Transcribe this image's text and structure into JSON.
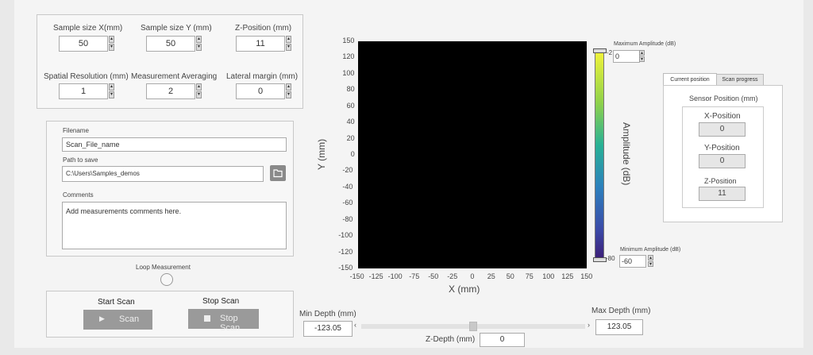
{
  "params": {
    "sample_x_label": "Sample size X(mm)",
    "sample_x_value": "50",
    "sample_y_label": "Sample size Y (mm)",
    "sample_y_value": "50",
    "zpos_label": "Z-Position (mm)",
    "zpos_value": "11",
    "spatial_label": "Spatial Resolution  (mm)",
    "spatial_value": "1",
    "averaging_label": "Measurement Averaging",
    "averaging_value": "2",
    "lateral_label": "Lateral margin  (mm)",
    "lateral_value": "0"
  },
  "file": {
    "filename_label": "Filename",
    "filename_value": "Scan_File_name",
    "path_label": "Path to save",
    "path_value": "C:\\Users\\Samples_demos",
    "comments_label": "Comments",
    "comments_value": "Add measurements comments here."
  },
  "loop": {
    "label": "Loop Measurement"
  },
  "controls": {
    "start_title": "Start Scan",
    "start_label": "Scan",
    "stop_title": "Stop Scan",
    "stop_label": "Stop Scan"
  },
  "plot": {
    "xlabel": "X (mm)",
    "ylabel": "Y (mm)",
    "xticks": [
      "-150",
      "-125",
      "-100",
      "-75",
      "-50",
      "-25",
      "0",
      "25",
      "50",
      "75",
      "100",
      "125",
      "150"
    ],
    "yticks": [
      "150",
      "120",
      "100",
      "80",
      "60",
      "40",
      "20",
      "0",
      "-20",
      "-40",
      "-60",
      "-80",
      "-100",
      "-120",
      "-150"
    ],
    "colorbar_label": "Amplitude (dB)",
    "cb_max_tick": "-2",
    "cb_min_tick": "-80",
    "max_amp_label": "Maximum Amplitude (dB)",
    "max_amp_value": "0",
    "min_amp_label": "Minimum Amplitude (dB)",
    "min_amp_value": "-60"
  },
  "depth": {
    "min_label": "Min Depth (mm)",
    "min_value": "-123.05",
    "max_label": "Max Depth (mm)",
    "max_value": "123.05",
    "z_label": "Z-Depth (mm)",
    "z_value": "0"
  },
  "sensor": {
    "tab_current": "Current position",
    "tab_progress": "Scan progress",
    "title": "Sensor Position (mm)",
    "x_label": "X-Position",
    "x_value": "0",
    "y_label": "Y-Position",
    "y_value": "0",
    "z_label": "Z-Position",
    "z_value": "11"
  }
}
